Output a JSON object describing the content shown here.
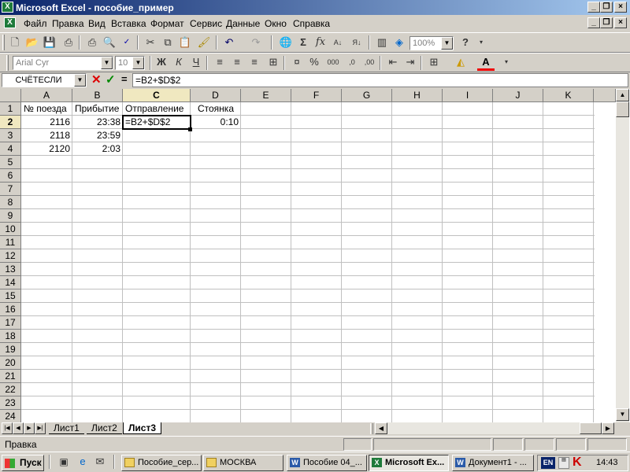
{
  "window": {
    "title": "Microsoft Excel - пособие_пример"
  },
  "menu": [
    "Файл",
    "Правка",
    "Вид",
    "Вставка",
    "Формат",
    "Сервис",
    "Данные",
    "Окно",
    "Справка"
  ],
  "toolbar": {
    "zoom": "100%"
  },
  "format": {
    "font": "Arial Cyr",
    "size": "10"
  },
  "formula_bar": {
    "name_box": "СЧЁТЕСЛИ",
    "formula": "=B2+$D$2"
  },
  "columns": [
    "A",
    "B",
    "C",
    "D",
    "E",
    "F",
    "G",
    "H",
    "I",
    "J",
    "K"
  ],
  "rows": [
    "1",
    "2",
    "3",
    "4",
    "5",
    "6",
    "7",
    "8",
    "9",
    "10",
    "11",
    "12",
    "13",
    "14",
    "15",
    "16",
    "17",
    "18",
    "19",
    "20",
    "21",
    "22",
    "23",
    "24"
  ],
  "cells": {
    "A1": "№ поезда",
    "B1": "Прибытие",
    "C1": "Отправление",
    "D1": "Стоянка",
    "A2": "2116",
    "B2": "23:38",
    "C2": "=B2+$D$2",
    "D2": "0:10",
    "A3": "2118",
    "B3": "23:59",
    "A4": "2120",
    "B4": "2:03"
  },
  "sheets": [
    "Лист1",
    "Лист2",
    "Лист3"
  ],
  "active_sheet": "Лист3",
  "status": "Правка",
  "taskbar": {
    "start": "Пуск",
    "tasks": [
      "Пособие_сер...",
      "МОСКВА",
      "Пособие 04_...",
      "Microsoft Ex...",
      "Документ1 - ..."
    ],
    "lang": "EN",
    "clock": "14:43"
  }
}
